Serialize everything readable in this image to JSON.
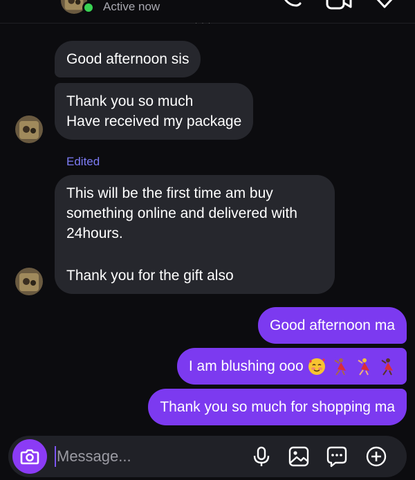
{
  "header": {
    "status": "Active now",
    "icons": [
      "chevron-left-icon",
      "phone-icon",
      "video-icon",
      "shield-icon"
    ]
  },
  "messages": {
    "incoming": [
      {
        "lines": [
          "Good afternoon sis"
        ]
      },
      {
        "lines": [
          "Thank you so much",
          "Have received my package"
        ]
      },
      {
        "lines": [
          "This will be the first time am buy",
          "something online and delivered with",
          "24hours.",
          "",
          "Thank you for the gift also"
        ]
      }
    ],
    "edited_label": "Edited",
    "outgoing": [
      {
        "text": "Good afternoon ma"
      },
      {
        "text": "I am blushing ooo",
        "emojis": [
          "smiling-face-with-hearts",
          "woman-dancing",
          "woman-dancing",
          "woman-dancing"
        ]
      },
      {
        "text": "Thank you so much for shopping ma"
      }
    ]
  },
  "composer": {
    "placeholder": "Message...",
    "icons": [
      "camera-icon",
      "microphone-icon",
      "gallery-icon",
      "sticker-icon",
      "plus-icon"
    ]
  },
  "colors": {
    "background": "#0c0c0f",
    "incoming_bubble": "#26272d",
    "outgoing_bubble": "#7c3af0",
    "accent": "#8b3bf5",
    "edited": "#7d7cf5",
    "online": "#39d353"
  }
}
